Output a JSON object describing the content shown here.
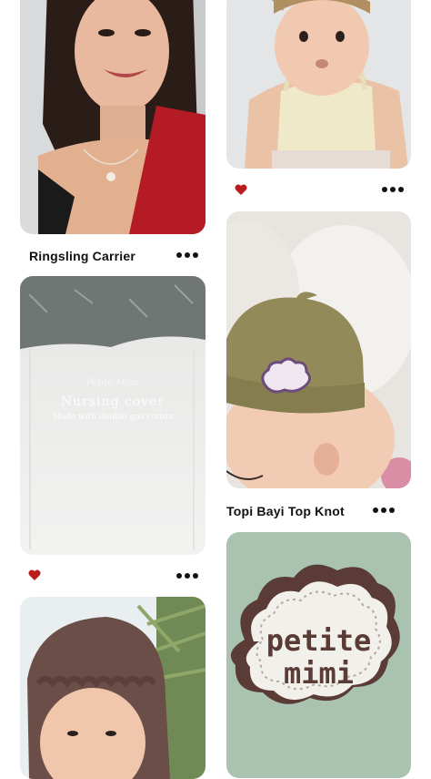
{
  "feed": {
    "pins": [
      {
        "id": "pin-1",
        "caption": "Ringsling Carrier"
      },
      {
        "id": "pin-2",
        "caption": ""
      },
      {
        "id": "pin-3",
        "caption": "Topi Bayi Top Knot"
      },
      {
        "id": "pin-4",
        "caption": "",
        "overlay_title": "Nursing cover",
        "overlay_subtitle": "Made with double gas cotton",
        "overlay_brand": "Petite Mimi"
      },
      {
        "id": "pin-5",
        "caption": ""
      },
      {
        "id": "pin-6",
        "caption": "",
        "label_text_line1": "petite",
        "label_text_line2": "mimi"
      }
    ]
  },
  "colors": {
    "heart": "#b91c1c",
    "text": "#111111",
    "background": "#ffffff"
  }
}
